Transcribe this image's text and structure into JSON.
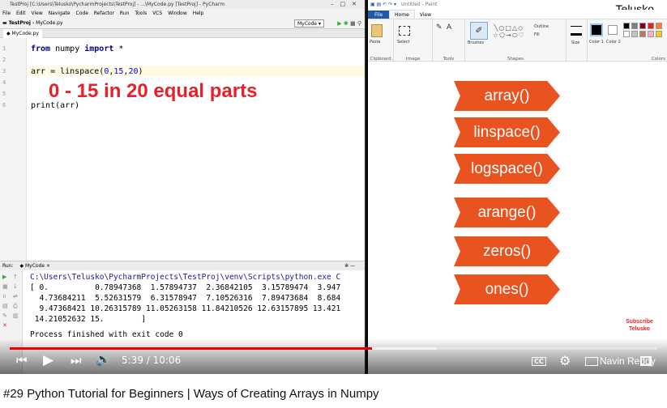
{
  "ide": {
    "title": "TestProj [C:\\Users\\Telusko\\PycharmProjects\\TestProj] - ...\\MyCode.py [TestProj] - PyCharm",
    "menu": [
      "File",
      "Edit",
      "View",
      "Navigate",
      "Code",
      "Refactor",
      "Run",
      "Tools",
      "VCS",
      "Window",
      "Help"
    ],
    "breadcrumb": [
      "TestProj",
      "MyCode.py"
    ],
    "run_config": "MyCode",
    "file_tab": "MyCode.py",
    "line_numbers": [
      "1",
      "2",
      "3",
      "4",
      "5",
      "6"
    ],
    "code": {
      "l1_kw1": "from",
      "l1_mid": " numpy ",
      "l1_kw2": "import",
      "l1_end": " *",
      "l3_a": "arr = linspace(",
      "l3_n1": "0",
      "l3_c1": ",",
      "l3_n2": "15",
      "l3_c2": ",",
      "l3_n3": "20",
      "l3_end": ")",
      "l6": "print(arr)"
    },
    "annotation": "0 - 15 in 20 equal parts"
  },
  "run": {
    "label": "Run:",
    "tab": "MyCode",
    "lines": [
      "C:\\Users\\Telusko\\PycharmProjects\\TestProj\\venv\\Scripts\\python.exe C",
      "[ 0.          0.78947368  1.57894737  2.36842105  3.15789474  3.947",
      "  4.73684211  5.52631579  6.31578947  7.10526316  7.89473684  8.684",
      "  9.47368421 10.26315789 11.05263158 11.84210526 12.63157895 13.421",
      " 14.21052632 15.        ]",
      "",
      "Process finished with exit code 0"
    ]
  },
  "paint": {
    "title": "Untitled - Paint",
    "tabs": [
      "File",
      "Home",
      "View"
    ],
    "groups": [
      "Clipboard",
      "Image",
      "Tools",
      "Shapes",
      "Colors"
    ],
    "tools": {
      "paste": "Paste",
      "select": "Select",
      "brushes": "Brushes",
      "outline": "Outline",
      "fill": "Fill",
      "size": "Size",
      "color1": "Color 1",
      "color2": "Color 2"
    },
    "palette": [
      "#000000",
      "#7f7f7f",
      "#880015",
      "#ed1c24",
      "#ff7f27",
      "#ffffff",
      "#c3c3c3",
      "#b97a57",
      "#ffaec9",
      "#ffc90e"
    ]
  },
  "brand": "Telusko",
  "shapes": [
    "array()",
    "linspace()",
    "logspace()",
    "arange()",
    "zeros()",
    "ones()"
  ],
  "subscribe": "Subscribe Telusko",
  "player": {
    "time": "5:39 / 10:06",
    "progress": 0.56,
    "buffered": 0.66,
    "watermark": "Navin Reddy",
    "cc": "CC"
  },
  "caption": "#29 Python Tutorial for Beginners | Ways of Creating Arrays in Numpy"
}
